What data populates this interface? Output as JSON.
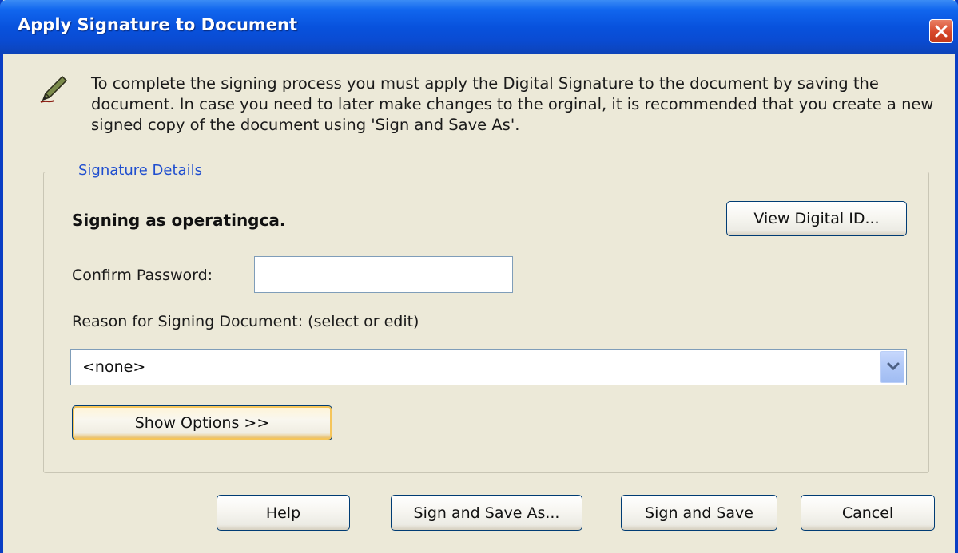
{
  "window": {
    "title": "Apply Signature to Document"
  },
  "info": {
    "icon": "pen-icon",
    "message": "To complete the signing process you must apply the Digital Signature to the document by saving the document. In case you need to later make changes to the orginal, it is recommended that you create a new signed copy of the document using 'Sign and Save As'."
  },
  "signature_details": {
    "legend": "Signature Details",
    "signing_as": "Signing as operatingca.",
    "view_digital_id_label": "View Digital ID...",
    "confirm_password_label": "Confirm Password:",
    "confirm_password_value": "",
    "reason_label": "Reason for Signing Document: (select or edit)",
    "reason_selected": "<none>",
    "show_options_label": "Show Options >>"
  },
  "footer": {
    "help_label": "Help",
    "sign_and_save_as_label": "Sign and Save As...",
    "sign_and_save_label": "Sign and Save",
    "cancel_label": "Cancel"
  },
  "colors": {
    "titlebar": "#0852dd",
    "dialog_background": "#ece9d8",
    "legend_text": "#1f4ecf",
    "close_button": "#d7472a"
  }
}
